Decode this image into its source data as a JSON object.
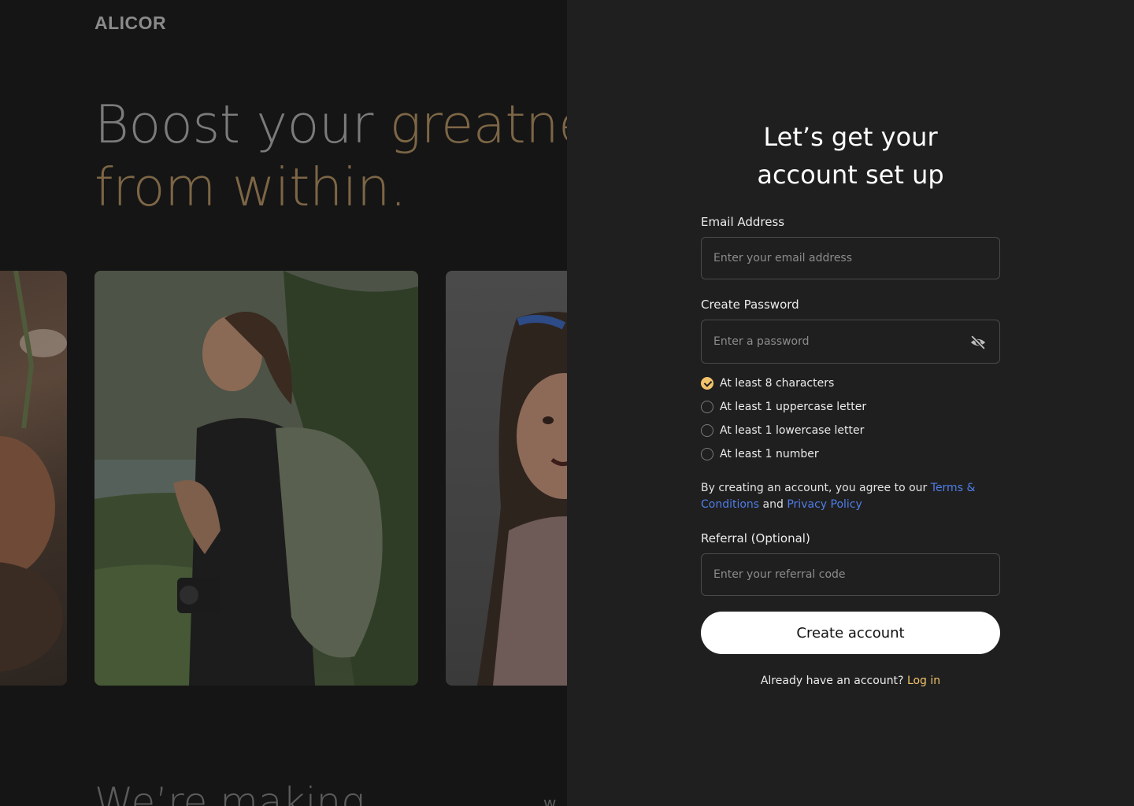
{
  "brand": {
    "logo": "ALICOR"
  },
  "hero": {
    "line1_plain": "Boost your ",
    "line1_accent": "greatness",
    "line2_accent": "from within."
  },
  "section_peek": {
    "heading": "We’re making",
    "side_text": "w"
  },
  "photos": [
    {
      "name": "photo-left-partial",
      "subject": "person seated indoors"
    },
    {
      "name": "photo-hiker",
      "subject": "woman with backpack and camera on a mountain"
    },
    {
      "name": "photo-girl",
      "subject": "smiling girl with headband"
    }
  ],
  "form": {
    "title_line1": "Let’s get your",
    "title_line2": "account set up",
    "email": {
      "label": "Email Address",
      "placeholder": "Enter your email address",
      "value": ""
    },
    "password": {
      "label": "Create Password",
      "placeholder": "Enter a password",
      "value": "",
      "toggle_icon": "eye-off-icon"
    },
    "rules": [
      {
        "text": "At least 8 characters",
        "met": true
      },
      {
        "text": "At least 1 uppercase letter",
        "met": false
      },
      {
        "text": "At least 1 lowercase letter",
        "met": false
      },
      {
        "text": "At least 1 number",
        "met": false
      }
    ],
    "terms": {
      "prefix": "By creating an account, you agree to our ",
      "terms_link": "Terms & Conditions",
      "middle": " and ",
      "privacy_link": "Privacy Policy"
    },
    "referral": {
      "label": "Referral (Optional)",
      "placeholder": "Enter your referral code",
      "value": ""
    },
    "submit_label": "Create account",
    "login_prompt": "Already have an account? ",
    "login_link": "Log in"
  },
  "colors": {
    "accent_gold": "#f2c36b",
    "link_blue": "#4f7de8",
    "panel_bg": "#1f1f1f",
    "left_bg": "#151515"
  }
}
